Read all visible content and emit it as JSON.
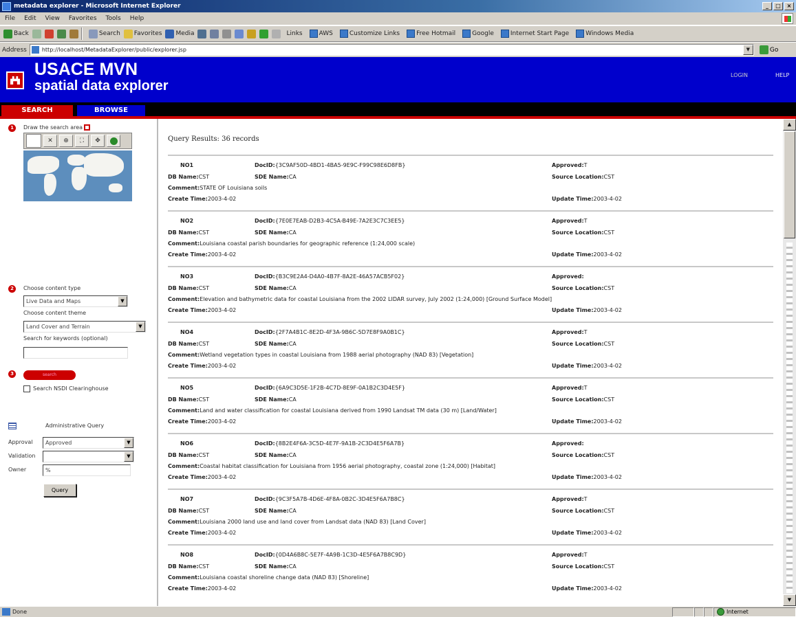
{
  "window": {
    "title": "metadata explorer - Microsoft Internet Explorer",
    "controls": [
      "_",
      "□",
      "×"
    ]
  },
  "menu": [
    "File",
    "Edit",
    "View",
    "Favorites",
    "Tools",
    "Help"
  ],
  "toolbar": {
    "back": "Back",
    "search": "Search",
    "favorites": "Favorites",
    "media": "Media",
    "links_label": "Links",
    "links": [
      "AWS",
      "Customize Links",
      "Free Hotmail",
      "Google",
      "Internet Start Page",
      "Windows Media"
    ]
  },
  "address": {
    "label": "Address",
    "url": "http://localhost/MetadataExplorer/public/explorer.jsp",
    "go": "Go"
  },
  "banner": {
    "title_line1": "USACE MVN",
    "title_line2": "spatial data explorer",
    "login": "LOGIN",
    "help": "HELP"
  },
  "tabs": {
    "search": "SEARCH",
    "browse": "BROWSE"
  },
  "left": {
    "step1_label": "Draw the search area",
    "step2_label": "Choose content type",
    "content_type_value": "Live Data and Maps",
    "step2b_label": "Choose content theme",
    "content_theme_value": "Land Cover and Terrain",
    "step2c_label": "Search for keywords (optional)",
    "keywords_value": "",
    "search_button": "search",
    "clearinghouse_label": "Search NSDI Clearinghouse",
    "advanced_label": "Administrative Query",
    "approval_label": "Approval",
    "approval_value": "Approved",
    "validation_label": "Validation",
    "validation_value": "",
    "owner_label": "Owner",
    "owner_value": "%",
    "query_button": "Query"
  },
  "results": {
    "header": "Query Results: 36 records",
    "labels": {
      "db": "DB Name:",
      "sde": "SDE Name:",
      "comment": "Comment:",
      "create": "Create Time:",
      "docid": "DocID:",
      "approved": "Approved:",
      "source": "Source Location:",
      "update": "Update Time:"
    },
    "records": [
      {
        "no": "NO1",
        "docid": "{3C9AF50D-4BD1-4BA5-9E9C-F99C98E6D8FB}",
        "approved": "T",
        "db": "CST",
        "sde": "CA",
        "source": "CST",
        "comment": "STATE OF Louisiana soils",
        "create": "2003-4-02",
        "update": "2003-4-02"
      },
      {
        "no": "NO2",
        "docid": "{7E0E7EAB-D2B3-4C5A-B49E-7A2E3C7C3EE5}",
        "approved": "T",
        "db": "CST",
        "sde": "CA",
        "source": "CST",
        "comment": "Louisiana coastal parish boundaries for geographic reference (1:24,000 scale)",
        "create": "2003-4-02",
        "update": "2003-4-02"
      },
      {
        "no": "NO3",
        "docid": "{B3C9E2A4-D4A0-4B7F-8A2E-46A57ACB5F02}",
        "approved": "",
        "db": "CST",
        "sde": "CA",
        "source": "CST",
        "comment": "Elevation and bathymetric data for coastal Louisiana from the 2002 LIDAR survey, July 2002 (1:24,000) [Ground Surface Model]",
        "create": "2003-4-02",
        "update": "2003-4-02"
      },
      {
        "no": "NO4",
        "docid": "{2F7A4B1C-8E2D-4F3A-9B6C-5D7E8F9A0B1C}",
        "approved": "T",
        "db": "CST",
        "sde": "CA",
        "source": "CST",
        "comment": "Wetland vegetation types in coastal Louisiana from 1988 aerial photography (NAD 83) [Vegetation]",
        "create": "2003-4-02",
        "update": "2003-4-02"
      },
      {
        "no": "NO5",
        "docid": "{6A9C3D5E-1F2B-4C7D-8E9F-0A1B2C3D4E5F}",
        "approved": "T",
        "db": "CST",
        "sde": "CA",
        "source": "CST",
        "comment": "Land and water classification for coastal Louisiana derived from 1990 Landsat TM data (30 m) [Land/Water]",
        "create": "2003-4-02",
        "update": "2003-4-02"
      },
      {
        "no": "NO6",
        "docid": "{8B2E4F6A-3C5D-4E7F-9A1B-2C3D4E5F6A7B}",
        "approved": "",
        "db": "CST",
        "sde": "CA",
        "source": "CST",
        "comment": "Coastal habitat classification for Louisiana from 1956 aerial photography, coastal zone (1:24,000) [Habitat]",
        "create": "2003-4-02",
        "update": "2003-4-02"
      },
      {
        "no": "NO7",
        "docid": "{9C3F5A7B-4D6E-4F8A-0B2C-3D4E5F6A7B8C}",
        "approved": "T",
        "db": "CST",
        "sde": "CA",
        "source": "CST",
        "comment": "Louisiana 2000 land use and land cover from Landsat data (NAD 83) [Land Cover]",
        "create": "2003-4-02",
        "update": "2003-4-02"
      },
      {
        "no": "NO8",
        "docid": "{0D4A6B8C-5E7F-4A9B-1C3D-4E5F6A7B8C9D}",
        "approved": "T",
        "db": "CST",
        "sde": "CA",
        "source": "CST",
        "comment": "Louisiana coastal shoreline change data (NAD 83) [Shoreline]",
        "create": "2003-4-02",
        "update": "2003-4-02"
      }
    ]
  },
  "status": {
    "text": "Done",
    "zone": "Internet"
  }
}
